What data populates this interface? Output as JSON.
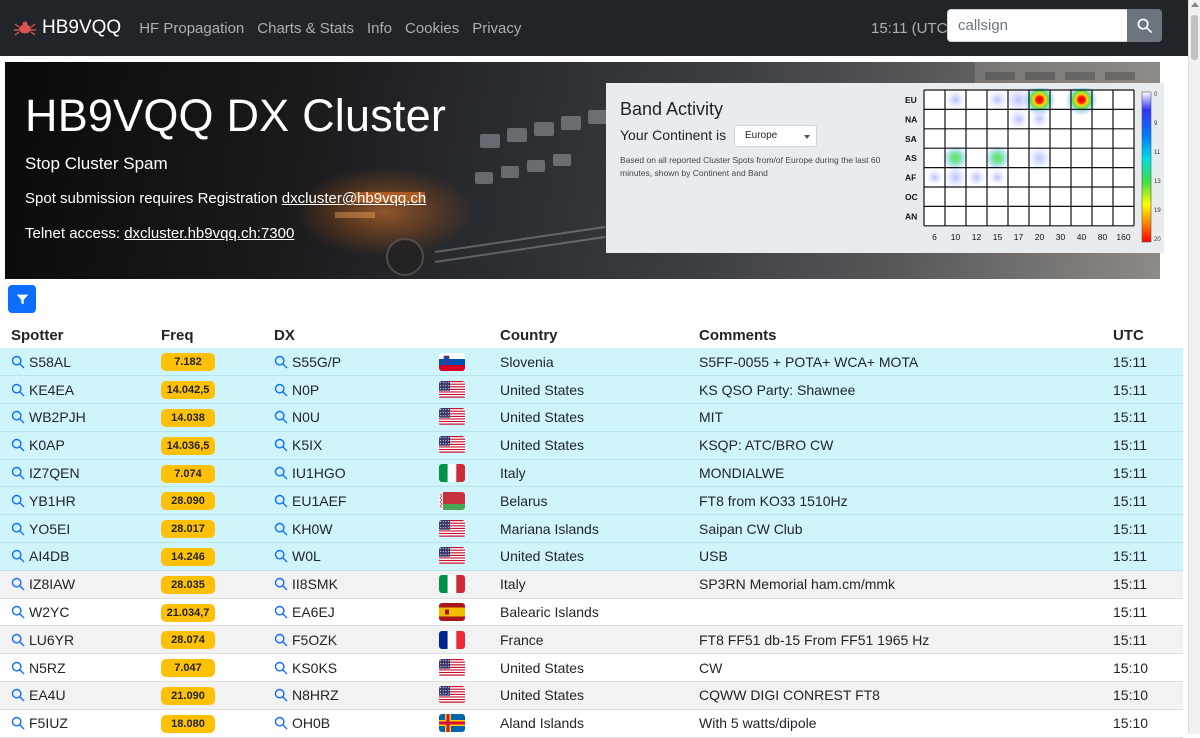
{
  "navbar": {
    "brand": "HB9VQQ",
    "links": [
      "HF Propagation",
      "Charts & Stats",
      "Info",
      "Cookies",
      "Privacy"
    ],
    "utc": "15:11 (UTC)",
    "search_placeholder": "callsign"
  },
  "hero": {
    "title": "HB9VQQ DX Cluster",
    "subtitle": "Stop Cluster Spam",
    "registration_text": "Spot submission requires Registration ",
    "registration_link": "dxcluster@hb9vqq.ch",
    "telnet_text": "Telnet access: ",
    "telnet_link": "dxcluster.hb9vqq.ch:7300"
  },
  "band_activity": {
    "title": "Band Activity",
    "continent_label": "Your Continent is",
    "continent_value": "Europe",
    "note": "Based on all reported Cluster Spots from/of Europe during the last 60 minutes, shown by Continent and Band",
    "continents": [
      "EU",
      "NA",
      "SA",
      "AS",
      "AF",
      "OC",
      "AN"
    ],
    "bands": [
      "6",
      "10",
      "12",
      "15",
      "17",
      "20",
      "30",
      "40",
      "80",
      "160"
    ],
    "scale_labels": [
      "0",
      "9",
      "11",
      "13",
      "19",
      "20"
    ]
  },
  "table": {
    "headers": [
      "Spotter",
      "Freq",
      "DX",
      "",
      "Country",
      "Comments",
      "UTC"
    ],
    "rows": [
      {
        "spotter": "S58AL",
        "freq": "7.182",
        "dx": "S55G/P",
        "flag": "si",
        "country": "Slovenia",
        "comment": "S5FF-0055 + POTA+ WCA+ MOTA",
        "utc": "15:11"
      },
      {
        "spotter": "KE4EA",
        "freq": "14.042,5",
        "dx": "N0P",
        "flag": "us",
        "country": "United States",
        "comment": "KS QSO Party: Shawnee",
        "utc": "15:11"
      },
      {
        "spotter": "WB2PJH",
        "freq": "14.038",
        "dx": "N0U",
        "flag": "us",
        "country": "United States",
        "comment": "MIT",
        "utc": "15:11"
      },
      {
        "spotter": "K0AP",
        "freq": "14.036,5",
        "dx": "K5IX",
        "flag": "us",
        "country": "United States",
        "comment": "KSQP: ATC/BRO CW",
        "utc": "15:11"
      },
      {
        "spotter": "IZ7QEN",
        "freq": "7.074",
        "dx": "IU1HGO",
        "flag": "it",
        "country": "Italy",
        "comment": "MONDIALWE",
        "utc": "15:11"
      },
      {
        "spotter": "YB1HR",
        "freq": "28.090",
        "dx": "EU1AEF",
        "flag": "by",
        "country": "Belarus",
        "comment": "FT8 from KO33 1510Hz",
        "utc": "15:11"
      },
      {
        "spotter": "YO5EI",
        "freq": "28.017",
        "dx": "KH0W",
        "flag": "us",
        "country": "Mariana Islands",
        "comment": "Saipan CW Club",
        "utc": "15:11"
      },
      {
        "spotter": "AI4DB",
        "freq": "14.246",
        "dx": "W0L",
        "flag": "us",
        "country": "United States",
        "comment": "USB",
        "utc": "15:11"
      },
      {
        "spotter": "IZ8IAW",
        "freq": "28.035",
        "dx": "II8SMK",
        "flag": "it",
        "country": "Italy",
        "comment": "SP3RN Memorial ham.cm/mmk",
        "utc": "15:11"
      },
      {
        "spotter": "W2YC",
        "freq": "21.034,7",
        "dx": "EA6EJ",
        "flag": "es",
        "country": "Balearic Islands",
        "comment": "",
        "utc": "15:11"
      },
      {
        "spotter": "LU6YR",
        "freq": "28.074",
        "dx": "F5OZK",
        "flag": "fr",
        "country": "France",
        "comment": "FT8 FF51 db-15 From FF51 1965 Hz",
        "utc": "15:11"
      },
      {
        "spotter": "N5RZ",
        "freq": "7.047",
        "dx": "KS0KS",
        "flag": "us",
        "country": "United States",
        "comment": "CW",
        "utc": "15:10"
      },
      {
        "spotter": "EA4U",
        "freq": "21.090",
        "dx": "N8HRZ",
        "flag": "us",
        "country": "United States",
        "comment": "CQWW DIGI CONREST FT8",
        "utc": "15:10"
      },
      {
        "spotter": "F5IUZ",
        "freq": "18.080",
        "dx": "OH0B",
        "flag": "ax",
        "country": "Aland Islands",
        "comment": "With 5 watts/dipole",
        "utc": "15:10"
      }
    ]
  },
  "colors": {
    "navbar": "#212529",
    "row_cyan": "#cff4fc",
    "row_gray": "#f2f2f2",
    "freq_badge": "#ffc107",
    "link_icon": "#0d6efd",
    "filter_button": "#0d6efd"
  }
}
